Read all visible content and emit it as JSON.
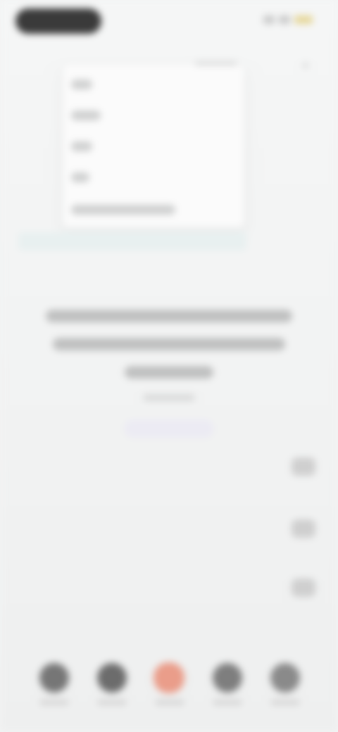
{
  "status_bar": {
    "pill": "status-pill",
    "icons": [
      "signal-icon",
      "wifi-icon",
      "battery-icon"
    ],
    "battery_color": "#e6d79a"
  },
  "close": {
    "icon": "close-icon"
  },
  "menu": {
    "items": [
      "",
      "",
      "",
      "",
      ""
    ]
  },
  "message": {
    "lines": [
      "",
      "",
      ""
    ],
    "subtext": "",
    "cta_label": ""
  },
  "side_actions": [
    "action-icon",
    "action-icon",
    "action-icon"
  ],
  "bottom_nav": {
    "items": [
      {
        "icon": "nav-icon",
        "label": ""
      },
      {
        "icon": "nav-icon",
        "label": ""
      },
      {
        "icon": "nav-icon",
        "label": "",
        "accent": "#ea9d8a"
      },
      {
        "icon": "nav-icon",
        "label": ""
      },
      {
        "icon": "nav-icon",
        "label": ""
      }
    ]
  }
}
